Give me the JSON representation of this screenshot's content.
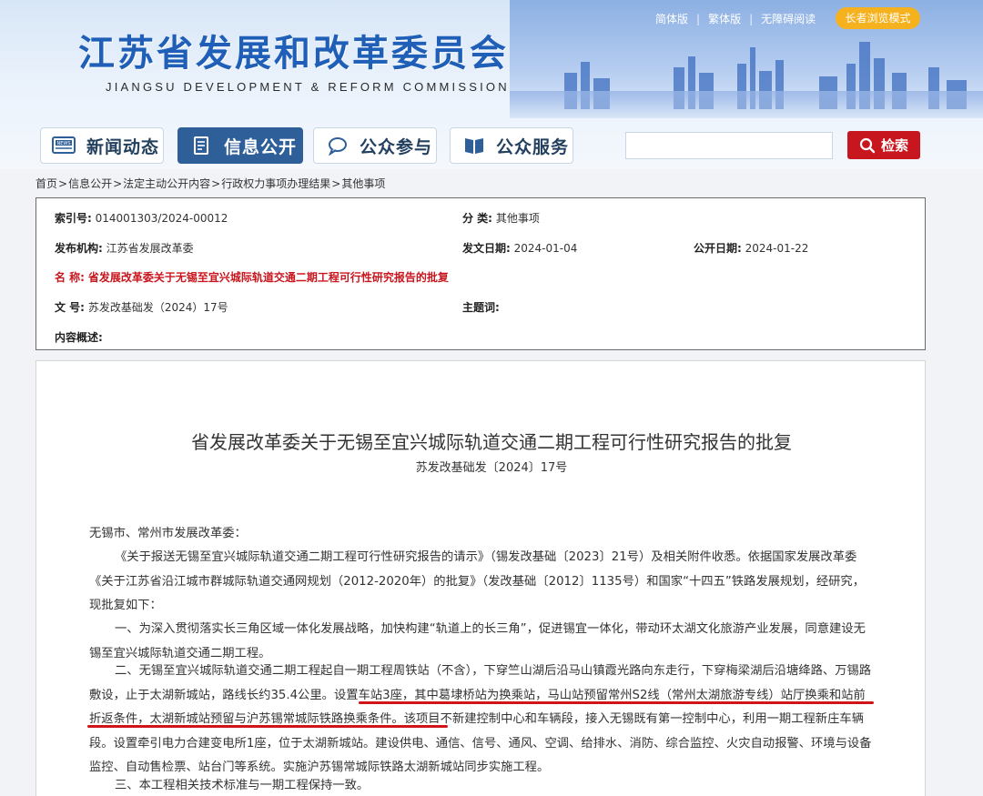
{
  "header": {
    "title": "江苏省发展和改革委员会",
    "subtitle": "JIANGSU DEVELOPMENT & REFORM COMMISSION",
    "links": [
      "简体版",
      "繁体版",
      "无障碍阅读"
    ],
    "elder_mode": "长者浏览模式"
  },
  "nav": [
    {
      "label": "新闻动态",
      "icon": "news-icon"
    },
    {
      "label": "信息公开",
      "icon": "document-icon"
    },
    {
      "label": "公众参与",
      "icon": "chat-icon"
    },
    {
      "label": "公众服务",
      "icon": "book-icon"
    }
  ],
  "search": {
    "placeholder": "",
    "button": "检索"
  },
  "breadcrumb": [
    "首页",
    "信息公开",
    "法定主动公开内容",
    "行政权力事项办理结果",
    "其他事项"
  ],
  "info": {
    "index_label": "索引号:",
    "index_value": "014001303/2024-00012",
    "category_label": "分    类:",
    "category_value": "其他事项",
    "publisher_label": "发布机构:",
    "publisher_value": "江苏省发展改革委",
    "doc_date_label": "发文日期:",
    "doc_date_value": "2024-01-04",
    "pub_date_label": "公开日期:",
    "pub_date_value": "2024-01-22",
    "name_label": "名    称:",
    "name_value": "省发展改革委关于无锡至宜兴城际轨道交通二期工程可行性研究报告的批复",
    "docno_label": "文    号:",
    "docno_value": "苏发改基础发（2024）17号",
    "keywords_label": "主题词:",
    "keywords_value": "",
    "summary_label": "内容概述:",
    "summary_value": ""
  },
  "document": {
    "title": "省发展改革委关于无锡至宜兴城际轨道交通二期工程可行性研究报告的批复",
    "doc_no": "苏发改基础发〔2024〕17号",
    "recipient": "无锡市、常州市发展改革委：",
    "p1": "《关于报送无锡至宜兴城际轨道交通二期工程可行性研究报告的请示》（锡发改基础〔2023〕21号）及相关附件收悉。依据国家发展改革委《关于江苏省沿江城市群城际轨道交通网规划（2012-2020年）的批复》（发改基础〔2012〕1135号）和国家“十四五”铁路发展规划，经研究，现批复如下：",
    "p2": "一、为深入贯彻落实长三角区域一体化发展战略，加快构建“轨道上的长三角”，促进锡宜一体化，带动环太湖文化旅游产业发展，同意建设无锡至宜兴城际轨道交通二期工程。",
    "p3": "二、无锡至宜兴城际轨道交通二期工程起自一期工程周铁站（不含），下穿竺山湖后沿马山镇霞光路向东走行，下穿梅梁湖后沿塘绛路、万锡路敷设，止于太湖新城站，路线长约35.4公里。设置车站3座，其中葛埭桥站为换乘站，马山站预留常州S2线（常州太湖旅游专线）站厅换乘和站前折返条件，太湖新城站预留与沪苏锡常城际铁路换乘条件。该项目不新建控制中心和车辆段，接入无锡既有第一控制中心，利用一期工程新庄车辆段。设置牵引电力合建变电所1座，位于太湖新城站。建设供电、通信、信号、通风、空调、给排水、消防、综合监控、火灾自动报警、环境与设备监控、自动售检票、站台门等系统。实施沪苏锡常城际铁路太湖新城站同步实施工程。",
    "p4": "三、本工程相关技术标准与一期工程保持一致。"
  },
  "colors": {
    "brand_blue": "#1f5fb8",
    "nav_active": "#2f5f98",
    "search_red": "#c8161e",
    "elder_yellow": "#f5b21e",
    "highlight_red": "#d0141c"
  }
}
